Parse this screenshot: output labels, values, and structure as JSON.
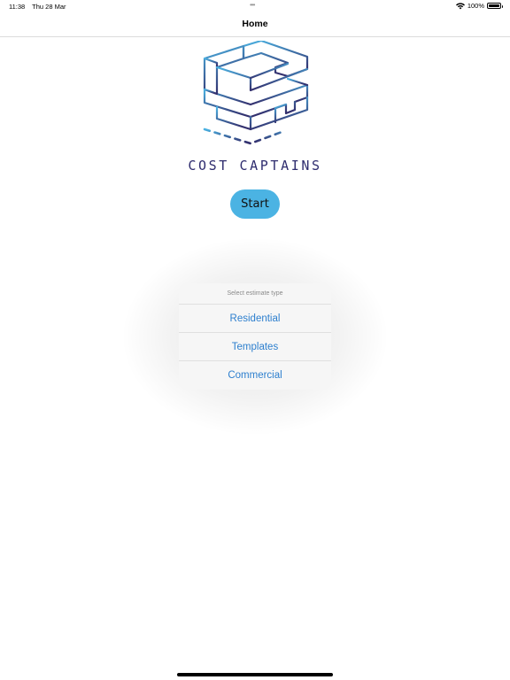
{
  "status_bar": {
    "time": "11:38",
    "date": "Thu 28 Mar",
    "battery": "100%",
    "battery_level": 1.0
  },
  "nav": {
    "title": "Home"
  },
  "brand": {
    "name": "COST CAPTAINS",
    "logo_colors": [
      "#4bb3e3",
      "#33306e"
    ]
  },
  "start_button": {
    "label": "Start",
    "color": "#4bb3e3"
  },
  "action_sheet": {
    "header": "Select estimate type",
    "options": [
      {
        "label": "Residential"
      },
      {
        "label": "Templates"
      },
      {
        "label": "Commercial"
      }
    ],
    "option_color": "#2d7fce"
  }
}
